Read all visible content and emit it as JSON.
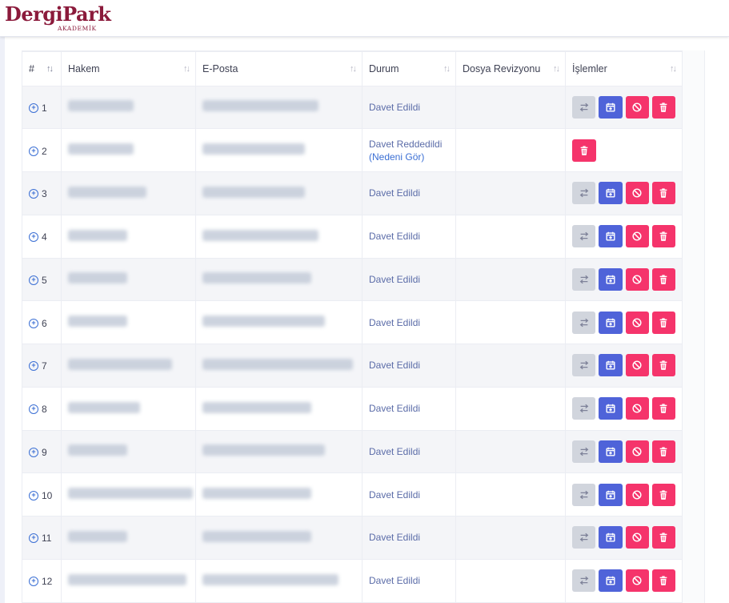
{
  "brand": {
    "name": "DergiPark",
    "sub": "AKADEMİK"
  },
  "table": {
    "headers": {
      "num": "#",
      "reviewer": "Hakem",
      "email": "E-Posta",
      "status": "Durum",
      "revision": "Dosya Revizyonu",
      "actions": "İşlemler"
    },
    "rows": [
      {
        "num": "1",
        "status": "Davet Edildi",
        "status_link": "",
        "actions": [
          "swap",
          "calendar",
          "ban",
          "delete"
        ]
      },
      {
        "num": "2",
        "status": "Davet Reddedildi",
        "status_link": "(Nedeni Gör)",
        "actions": [
          "delete"
        ]
      },
      {
        "num": "3",
        "status": "Davet Edildi",
        "status_link": "",
        "actions": [
          "swap",
          "calendar",
          "ban",
          "delete"
        ]
      },
      {
        "num": "4",
        "status": "Davet Edildi",
        "status_link": "",
        "actions": [
          "swap",
          "calendar",
          "ban",
          "delete"
        ]
      },
      {
        "num": "5",
        "status": "Davet Edildi",
        "status_link": "",
        "actions": [
          "swap",
          "calendar",
          "ban",
          "delete"
        ]
      },
      {
        "num": "6",
        "status": "Davet Edildi",
        "status_link": "",
        "actions": [
          "swap",
          "calendar",
          "ban",
          "delete"
        ]
      },
      {
        "num": "7",
        "status": "Davet Edildi",
        "status_link": "",
        "actions": [
          "swap",
          "calendar",
          "ban",
          "delete"
        ]
      },
      {
        "num": "8",
        "status": "Davet Edildi",
        "status_link": "",
        "actions": [
          "swap",
          "calendar",
          "ban",
          "delete"
        ]
      },
      {
        "num": "9",
        "status": "Davet Edildi",
        "status_link": "",
        "actions": [
          "swap",
          "calendar",
          "ban",
          "delete"
        ]
      },
      {
        "num": "10",
        "status": "Davet Edildi",
        "status_link": "",
        "actions": [
          "swap",
          "calendar",
          "ban",
          "delete"
        ]
      },
      {
        "num": "11",
        "status": "Davet Edildi",
        "status_link": "",
        "actions": [
          "swap",
          "calendar",
          "ban",
          "delete"
        ]
      },
      {
        "num": "12",
        "status": "Davet Edildi",
        "status_link": "",
        "actions": [
          "swap",
          "calendar",
          "ban",
          "delete"
        ]
      }
    ]
  },
  "colors": {
    "brand": "#8b1a3b",
    "swap_button": "#d1d5dd",
    "calendar_button": "#4f63d9",
    "danger_button": "#f5346b",
    "status_text": "#5b6ca8",
    "link": "#3b6fd4"
  }
}
